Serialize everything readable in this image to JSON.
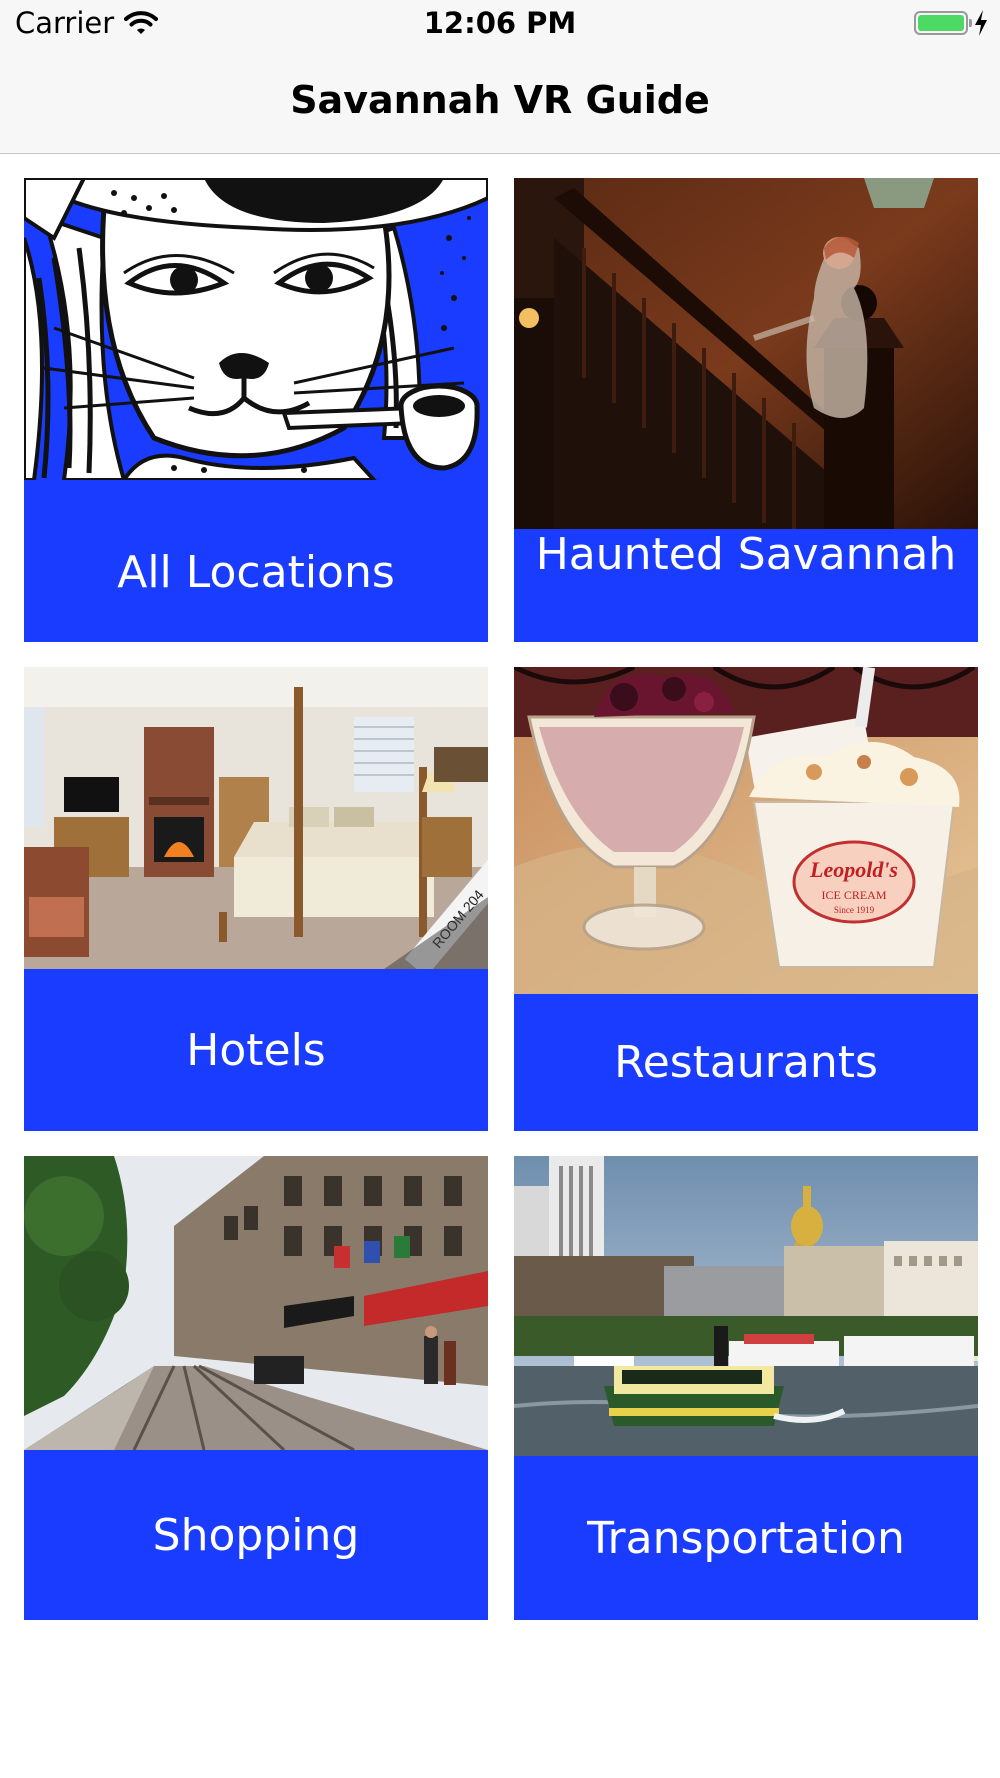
{
  "status_bar": {
    "carrier": "Carrier",
    "time": "12:06 PM",
    "wifi_icon": "wifi-icon",
    "battery_icon": "battery-icon",
    "charging_icon": "charging-bolt-icon",
    "battery_color": "#4cd964"
  },
  "nav": {
    "title": "Savannah VR Guide"
  },
  "accent_color": "#1a3cff",
  "tiles": [
    {
      "label": "All Locations",
      "image": "cat-with-pipe-illustration"
    },
    {
      "label": "Haunted Savannah",
      "image": "ghost-on-staircase-photo"
    },
    {
      "label": "Hotels",
      "image": "hotel-room-photo"
    },
    {
      "label": "Restaurants",
      "image": "ice-cream-sundae-photo"
    },
    {
      "label": "Shopping",
      "image": "river-street-photo"
    },
    {
      "label": "Transportation",
      "image": "river-ferry-photo"
    }
  ],
  "photo_text": {
    "room_sign": "ROOM 204",
    "cup_brand": "Leopold's",
    "cup_sub": "ICE CREAM",
    "cup_year": "Since 1919"
  }
}
